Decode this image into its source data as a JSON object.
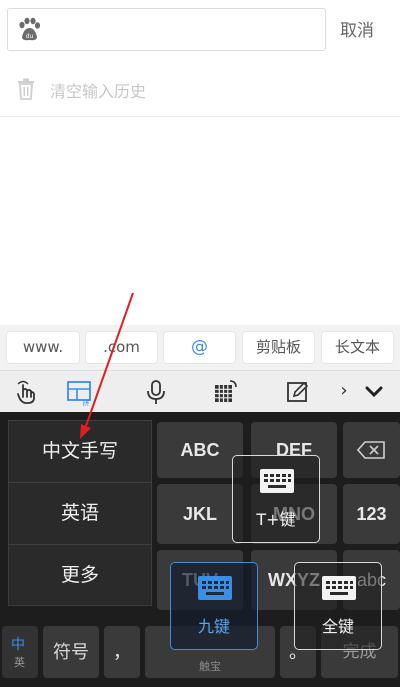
{
  "search": {
    "cancel_label": "取消",
    "placeholder": ""
  },
  "history": {
    "clear_label": "清空输入历史"
  },
  "quickbar": {
    "items": [
      "www.",
      ".com",
      "@",
      "剪贴板",
      "长文本"
    ]
  },
  "toolbar": {
    "icons": [
      "gesture-icon",
      "layout-icon",
      "mic-icon",
      "grid-icon",
      "edit-icon",
      "arrow-right-icon",
      "collapse-icon"
    ],
    "arrow": "›"
  },
  "keyboard": {
    "keys_row1": [
      "ABC",
      "DEF"
    ],
    "keys_row2": [
      "JKL",
      "MNO",
      "123"
    ],
    "keys_row3": [
      "TUV",
      "WXYZ",
      "abc"
    ],
    "bottom": {
      "lang_cn": "中",
      "lang_en": "英",
      "symbol": "符号",
      "comma": "，",
      "space_hint": "触宝",
      "period": "。",
      "done": "完成"
    }
  },
  "menu": {
    "items": [
      "中文手写",
      "英语",
      "更多"
    ]
  },
  "layout_options": [
    {
      "label": "T+键",
      "active": false
    },
    {
      "label": "九键",
      "active": true
    },
    {
      "label": "全键",
      "active": false
    }
  ],
  "colors": {
    "accent": "#3a8ee6",
    "annotation": "#e01e1e",
    "keyboard_bg": "#1d1d1d"
  }
}
